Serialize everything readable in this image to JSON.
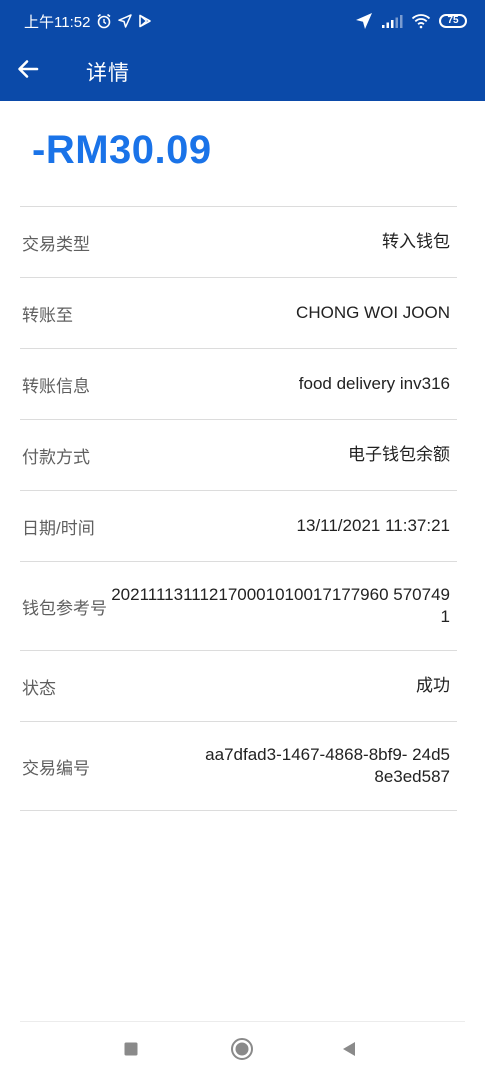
{
  "status_bar": {
    "time": "上午11:52",
    "battery": "75",
    "icons": [
      "alarm-icon",
      "location-arrow-icon",
      "play-store-icon",
      "location-icon",
      "signal-icon",
      "wifi-icon",
      "battery-icon"
    ]
  },
  "app_bar": {
    "title": "详情",
    "back_icon": "arrow-left-icon"
  },
  "amount": "-RM30.09",
  "colors": {
    "header": "#0b4aa9",
    "amount": "#1a73e8"
  },
  "details": [
    {
      "label": "交易类型",
      "value": "转入钱包"
    },
    {
      "label": "转账至",
      "value": "CHONG WOI JOON"
    },
    {
      "label": "转账信息",
      "value": "food delivery inv316"
    },
    {
      "label": "付款方式",
      "value": "电子钱包余额"
    },
    {
      "label": "日期/时间",
      "value": "13/11/2021 11:37:21"
    },
    {
      "label": "钱包参考号",
      "value": "202111131112170001010017177960 5707491"
    },
    {
      "label": "状态",
      "value": "成功"
    },
    {
      "label": "交易编号",
      "value": "aa7dfad3-1467-4868-8bf9- 24d58e3ed587"
    }
  ],
  "nav_bar": {
    "icons": [
      "recent-apps-icon",
      "home-icon",
      "back-icon"
    ]
  }
}
